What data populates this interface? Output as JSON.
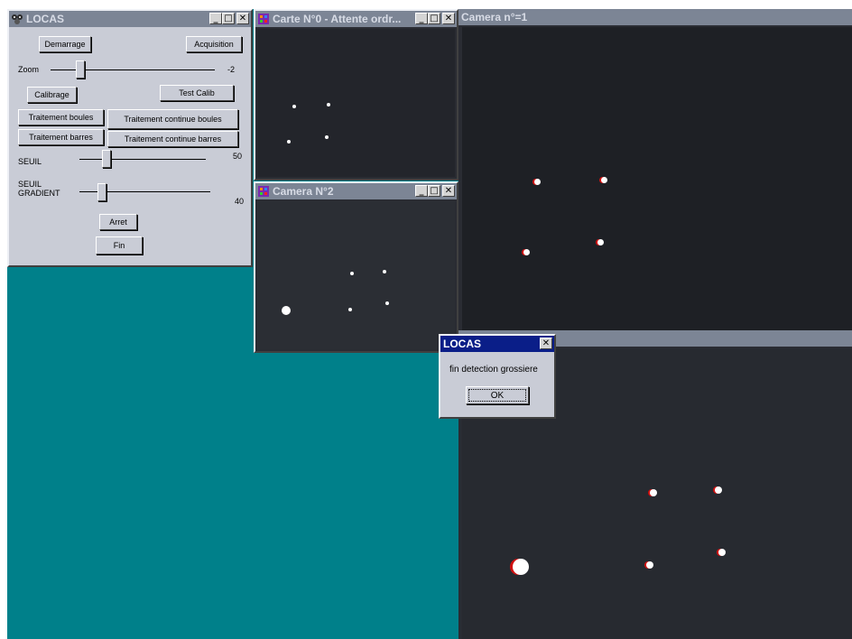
{
  "control": {
    "title": "LOCAS",
    "buttons": {
      "demarrage": "Demarrage",
      "acquisition": "Acquisition",
      "calibrage": "Calibrage",
      "test_calib": "Test Calib",
      "traitement_boules": "Traitement boules",
      "traitement_continue_boules": "Traitement continue boules",
      "traitement_barres": "Traitement barres",
      "traitement_continue_barres": "Traitement continue barres",
      "arret": "Arret",
      "fin": "Fin"
    },
    "zoom": {
      "label": "Zoom",
      "value": "-2"
    },
    "seuil": {
      "label": "SEUIL",
      "value": "50"
    },
    "seuil_gradient": {
      "label1": "SEUIL",
      "label2": "GRADIENT",
      "value": "40"
    }
  },
  "carte": {
    "title": "Carte N°0 - Attente ordr..."
  },
  "camera2": {
    "title": "Camera N°2"
  },
  "camera1": {
    "title": "Camera n°=1"
  },
  "dialog": {
    "title": "LOCAS",
    "message": "fin detection grossiere",
    "ok": "OK"
  },
  "titlebar_buttons": {
    "minimize": "_",
    "maximize": "□",
    "close": "✕"
  },
  "colors": {
    "desktop": "#00808a",
    "titlebar_inactive": "#7c8595",
    "titlebar_active": "#0a1e88",
    "window": "#c9ccd6"
  }
}
